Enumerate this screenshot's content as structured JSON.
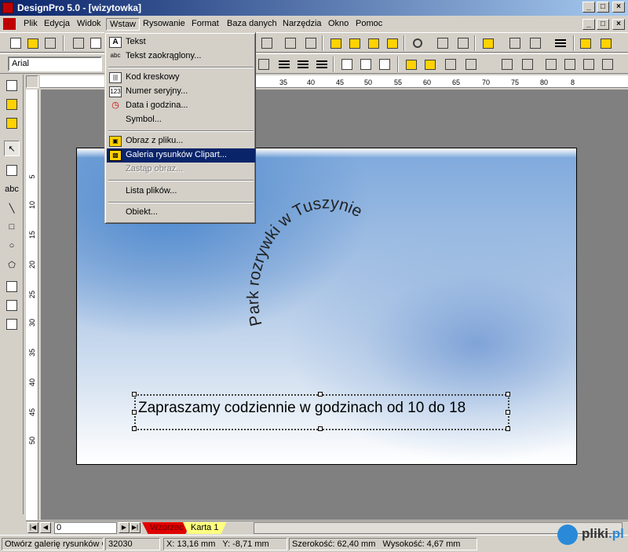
{
  "window": {
    "title": "DesignPro 5.0 - [wizytowka]",
    "btn_min": "_",
    "btn_max": "□",
    "btn_close": "×"
  },
  "menubar": {
    "items": [
      "Plik",
      "Edycja",
      "Widok",
      "Wstaw",
      "Rysowanie",
      "Format",
      "Baza danych",
      "Narzędzia",
      "Okno",
      "Pomoc"
    ],
    "active": "Wstaw"
  },
  "toolbar2": {
    "font": "Arial"
  },
  "insert_menu": {
    "items": [
      {
        "label": "Tekst",
        "icon": "text-frame-icon",
        "glyph": "A"
      },
      {
        "label": "Tekst zaokrąglony...",
        "icon": "curved-text-icon",
        "glyph": "abc"
      },
      {
        "label": "Kod kreskowy",
        "icon": "barcode-icon",
        "glyph": "|||"
      },
      {
        "label": "Numer seryjny...",
        "icon": "serial-number-icon",
        "glyph": "123"
      },
      {
        "label": "Data i godzina...",
        "icon": "date-time-icon",
        "glyph": "◷"
      },
      {
        "label": "Symbol...",
        "icon": "",
        "glyph": ""
      },
      {
        "label": "Obraz z pliku...",
        "icon": "image-file-icon",
        "glyph": "▣"
      },
      {
        "label": "Galeria rysunków Clipart...",
        "icon": "clipart-gallery-icon",
        "glyph": "▩"
      },
      {
        "label": "Zastąp obraz...",
        "icon": "",
        "glyph": ""
      },
      {
        "label": "Lista plików...",
        "icon": "",
        "glyph": ""
      },
      {
        "label": "Obiekt...",
        "icon": "",
        "glyph": ""
      }
    ]
  },
  "hruler": {
    "ticks": [
      "35",
      "40",
      "45",
      "50",
      "55",
      "60",
      "65",
      "70",
      "75",
      "80",
      "8"
    ]
  },
  "vruler": {
    "ticks": [
      "5",
      "10",
      "15",
      "20",
      "25",
      "30",
      "35",
      "40",
      "45",
      "50"
    ]
  },
  "card": {
    "arc_text": "Park rozrywki w Tuszynie",
    "selected_text": "Zapraszamy codziennie w godzinach od 10 do 18"
  },
  "bottom": {
    "page": "0",
    "tabs": [
      "Wzorzec",
      "Karta 1"
    ]
  },
  "status": {
    "help": "Otwórz galerię rysunków C",
    "code": "32030",
    "x": "X: 13,16 mm",
    "y": "Y: -8,71 mm",
    "width": "Szerokość: 62,40 mm",
    "height": "Wysokość: 4,67 mm"
  },
  "watermark": {
    "brand": "pliki",
    "tld": ".pl"
  }
}
